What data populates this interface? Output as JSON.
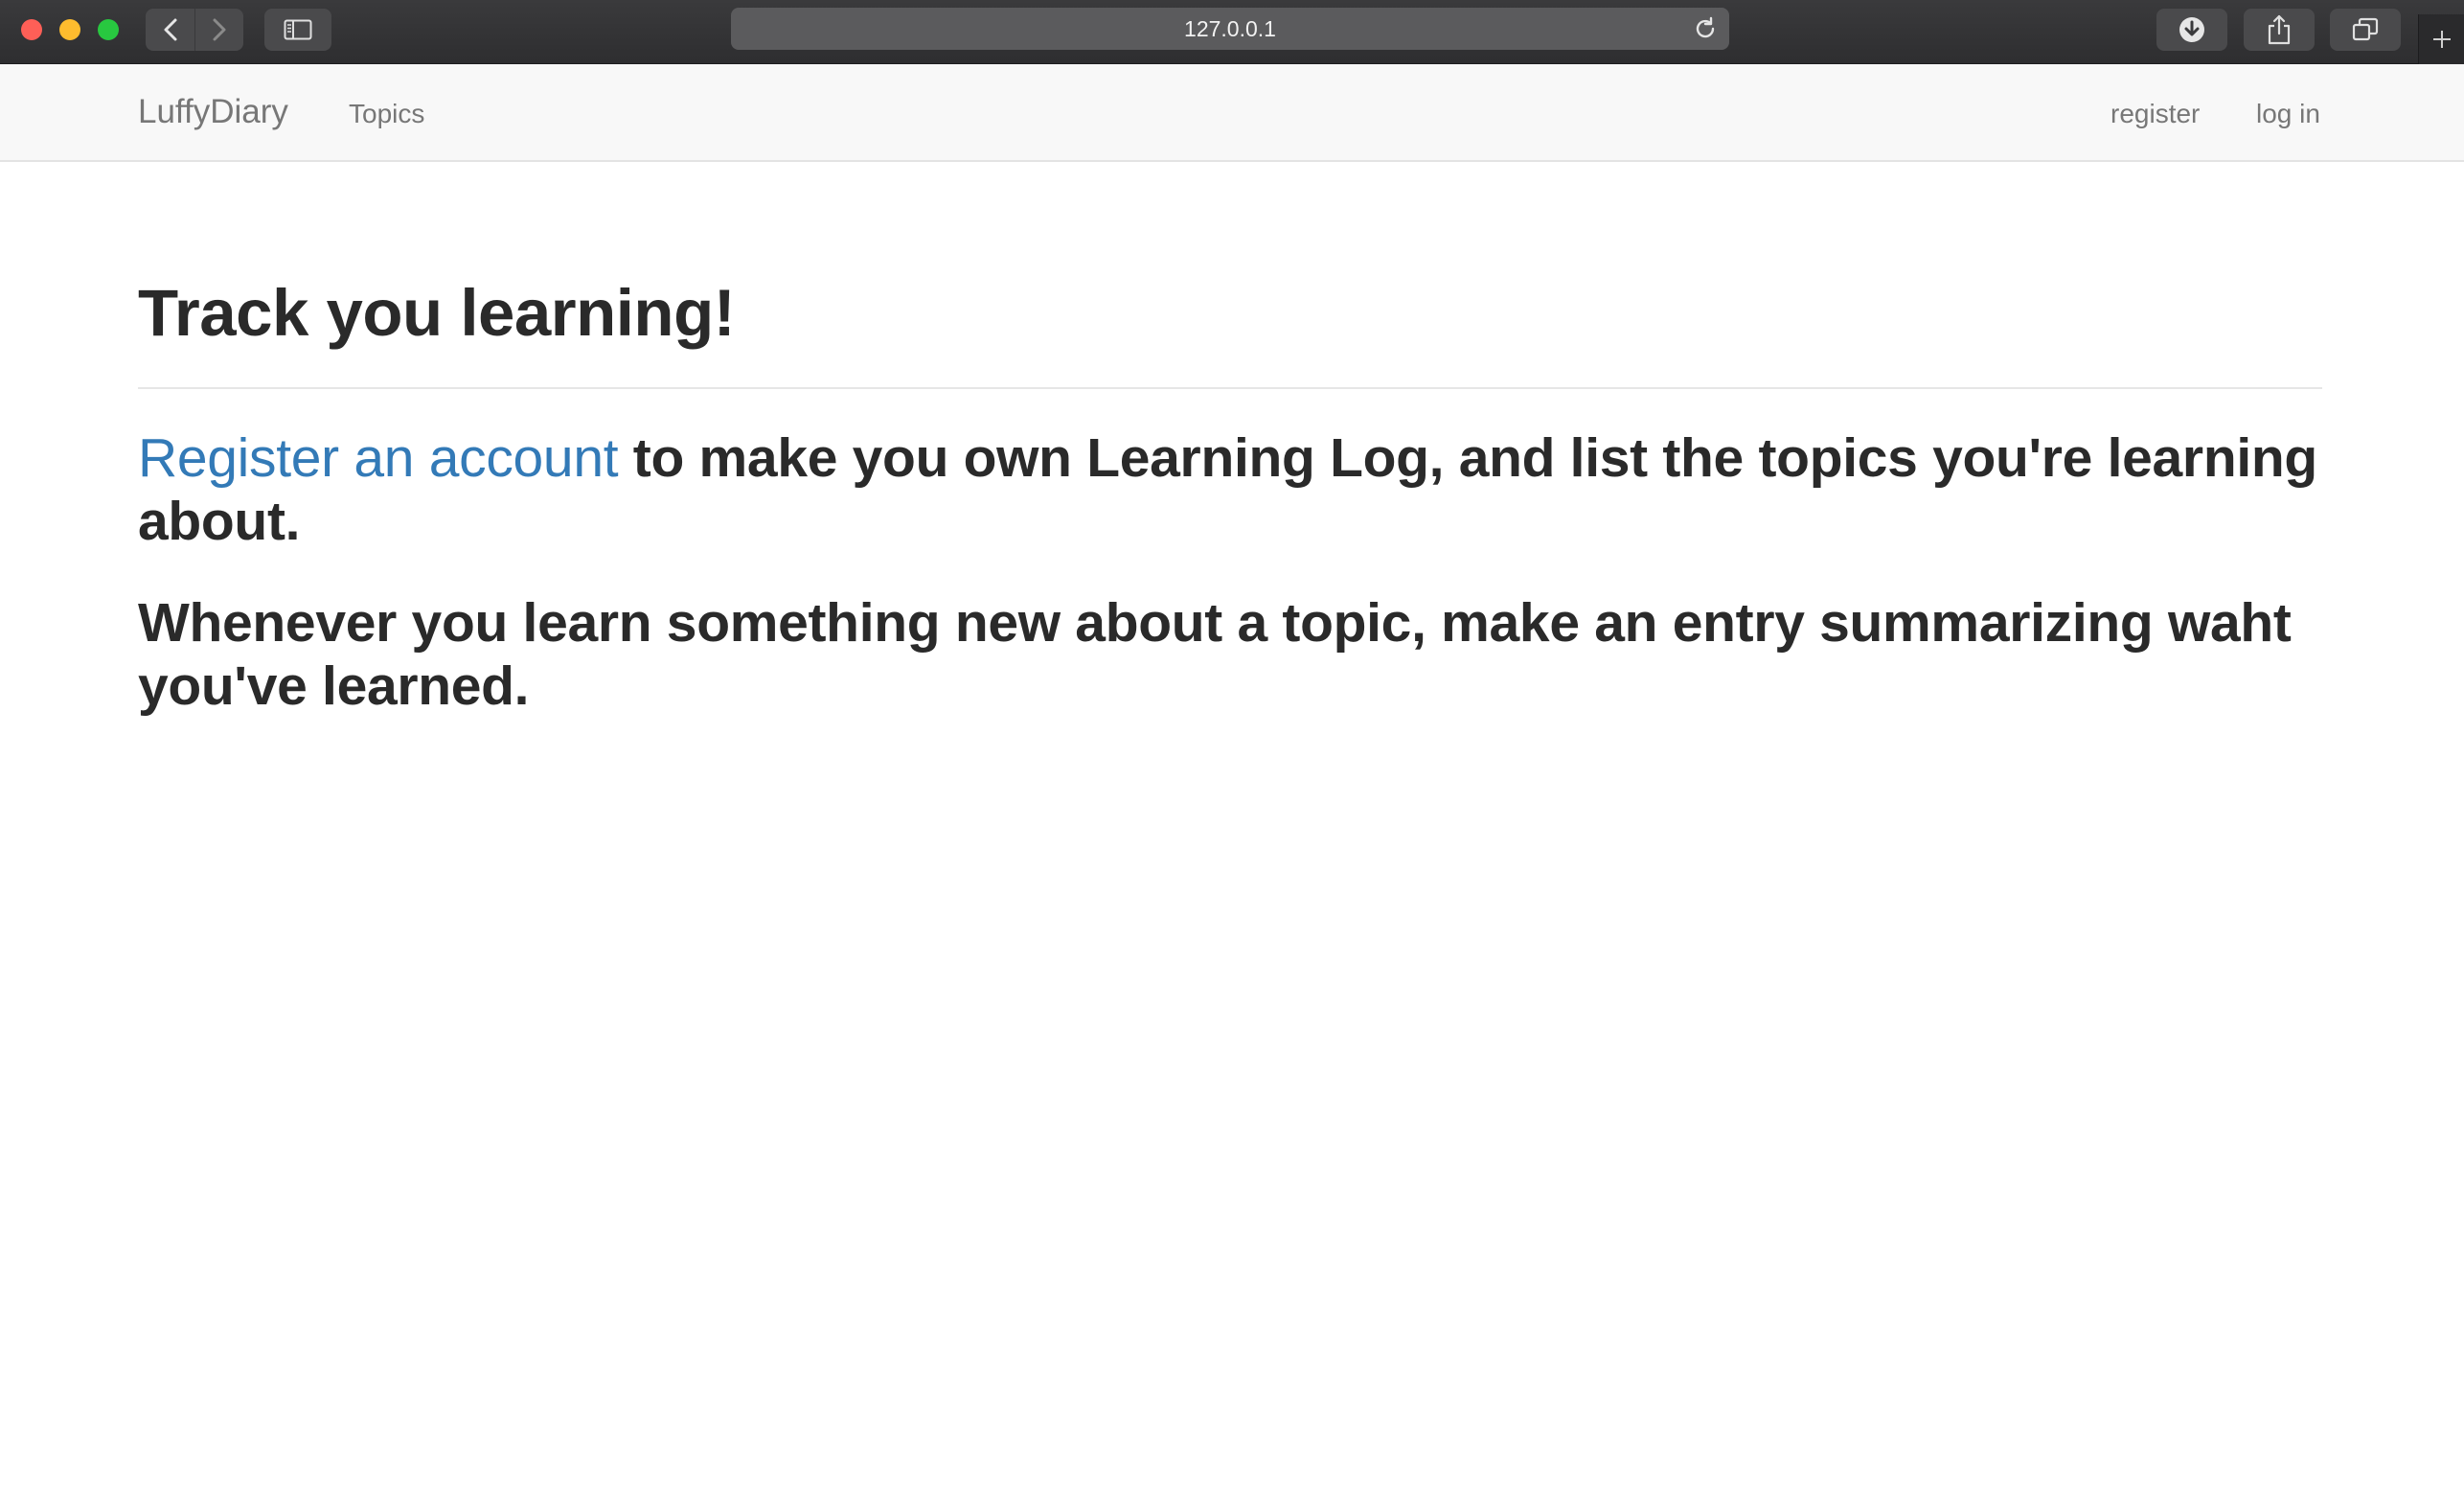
{
  "browser": {
    "url": "127.0.0.1"
  },
  "navbar": {
    "brand": "LuffyDiary",
    "topics_label": "Topics",
    "register_label": "register",
    "login_label": "log in"
  },
  "main": {
    "title": "Track you learning!",
    "lead1": {
      "link_text": "Register an account",
      "rest_text": " to make you own Learning Log, and list the topics you're learning about."
    },
    "lead2": "Whenever you learn something new about a topic, make an entry summarizing waht you've learned."
  },
  "colors": {
    "link": "#337ab7",
    "navbar_bg": "#f8f8f8",
    "chrome_bg": "#2e2e30"
  },
  "icons": {
    "back": "chevron-left-icon",
    "forward": "chevron-right-icon",
    "sidebar": "sidebar-icon",
    "reload": "reload-icon",
    "downloads": "download-icon",
    "share": "share-icon",
    "tabs": "tabs-icon",
    "new_tab": "plus-icon"
  }
}
